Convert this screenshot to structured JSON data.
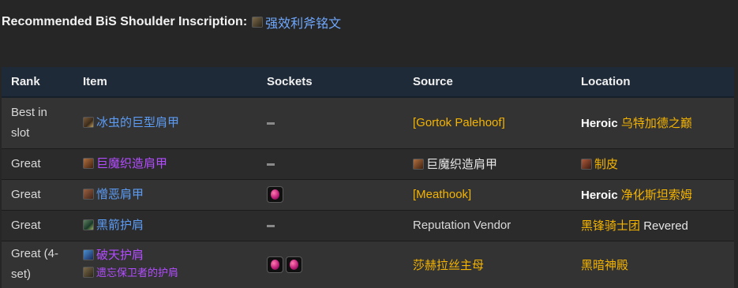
{
  "heading": {
    "label": "Recommended BiS Shoulder Inscription:",
    "inscription": "强效利斧铭文",
    "inscription_icon": "inscription-icon"
  },
  "table": {
    "columns": [
      "Rank",
      "Item",
      "Sockets",
      "Source",
      "Location"
    ],
    "rows": [
      {
        "rank": "Best in slot",
        "items": [
          {
            "name": "冰虫的巨型肩甲",
            "quality": "blue",
            "icon": "shoulder-icon"
          }
        ],
        "sockets": [],
        "source": "[Gortok Palehoof]",
        "location_prefix": "Heroic",
        "location": "乌特加德之巅"
      },
      {
        "rank": "Great",
        "items": [
          {
            "name": "巨魔织造肩甲",
            "quality": "purple",
            "icon": "shoulder-icon"
          }
        ],
        "sockets": [],
        "source": "巨魔织造肩甲",
        "location_prefix": "",
        "location": "制皮"
      },
      {
        "rank": "Great",
        "items": [
          {
            "name": "憎恶肩甲",
            "quality": "blue",
            "icon": "shoulder-icon"
          }
        ],
        "sockets": [
          "red-socket"
        ],
        "source": "[Meathook]",
        "location_prefix": "Heroic",
        "location": "净化斯坦索姆"
      },
      {
        "rank": "Great",
        "items": [
          {
            "name": "黑箭护肩",
            "quality": "blue",
            "icon": "shoulder-icon"
          }
        ],
        "sockets": [],
        "source": "Reputation Vendor",
        "location_prefix": "",
        "location": "黑锋骑士团",
        "location_suffix": "Revered"
      },
      {
        "rank": "Great (4-set)",
        "items": [
          {
            "name": "破天护肩",
            "quality": "purple",
            "icon": "shoulder-icon"
          },
          {
            "name": "遗忘保卫者的护肩",
            "quality": "purple",
            "icon": "token-icon"
          }
        ],
        "sockets": [
          "red-socket",
          "red-socket"
        ],
        "source": "莎赫拉丝主母",
        "location_prefix": "",
        "location": "黑暗神殿"
      }
    ]
  },
  "colors": {
    "background": "#262626",
    "header_bg": "#1e2a38",
    "blue_quality": "#5d9cf5",
    "epic_quality": "#b34dff",
    "gold_text": "#f5b400"
  }
}
